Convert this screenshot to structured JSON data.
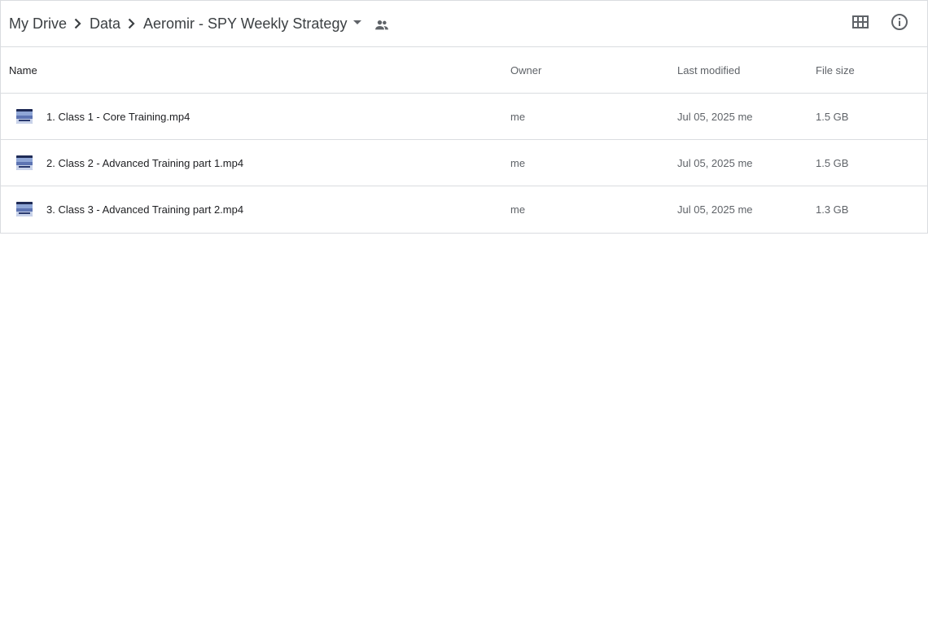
{
  "breadcrumb": {
    "items": [
      {
        "label": "My Drive"
      },
      {
        "label": "Data"
      },
      {
        "label": "Aeromir - SPY Weekly Strategy"
      }
    ]
  },
  "icons": {
    "separator": "chevron-right-icon",
    "dropdown": "arrow-drop-down-icon",
    "shared": "people-icon",
    "grid": "grid-view-icon",
    "info": "info-icon",
    "file": "video-thumbnail-icon"
  },
  "columns": {
    "name": "Name",
    "owner": "Owner",
    "modified": "Last modified",
    "size": "File size"
  },
  "files": [
    {
      "name": "1. Class 1 - Core Training.mp4",
      "owner": "me",
      "modified": "Jul 05, 2025 me",
      "size": "1.5 GB"
    },
    {
      "name": "2. Class 2 - Advanced Training part 1.mp4",
      "owner": "me",
      "modified": "Jul 05, 2025 me",
      "size": "1.5 GB"
    },
    {
      "name": "3. Class 3 - Advanced Training part 2.mp4",
      "owner": "me",
      "modified": "Jul 05, 2025 me",
      "size": "1.3 GB"
    }
  ],
  "colors": {
    "border": "#dadce0",
    "text_primary": "#202124",
    "text_secondary": "#5f6368",
    "icon": "#5f6368"
  }
}
